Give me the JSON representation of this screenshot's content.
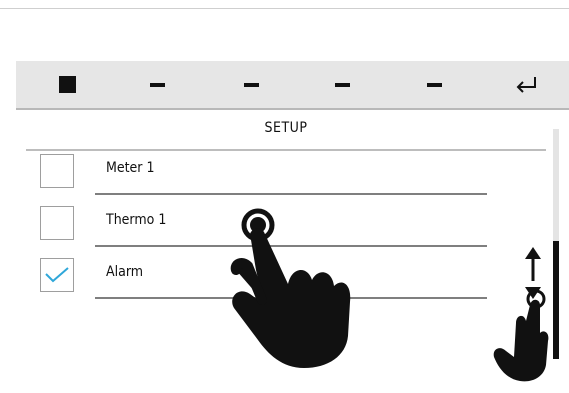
{
  "toolbar": {
    "buttons": [
      {
        "icon": "stop-icon"
      },
      {
        "icon": "dash-icon"
      },
      {
        "icon": "dash-icon"
      },
      {
        "icon": "dash-icon"
      },
      {
        "icon": "dash-icon"
      },
      {
        "icon": "return-icon"
      }
    ]
  },
  "setup": {
    "title": "SETUP",
    "items": [
      {
        "label": "Meter 1",
        "checked": false
      },
      {
        "label": "Thermo 1",
        "checked": false
      },
      {
        "label": "Alarm",
        "checked": true
      }
    ]
  },
  "scroll": {
    "position": 1.0
  },
  "colors": {
    "check": "#2fa7d9",
    "toolbar": "#e6e6e6",
    "text": "#111111"
  },
  "gestures": [
    {
      "type": "tap",
      "target": "Thermo 1"
    },
    {
      "type": "swipe",
      "direction": "vertical",
      "target": "scrollbar"
    }
  ]
}
